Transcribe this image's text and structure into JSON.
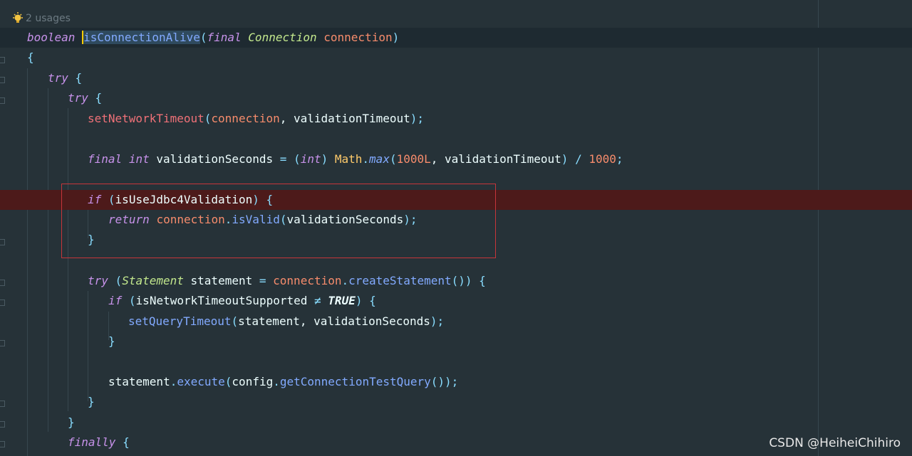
{
  "hint": {
    "usages": "2 usages",
    "icon": "lightbulb-icon"
  },
  "code": {
    "l1": {
      "t1": "boolean",
      "t2": "isConnectionAlive",
      "t3": "(",
      "t4": "final",
      "t5": "Connection",
      "t6": "connection",
      "t7": ")"
    },
    "l2": {
      "t1": "{"
    },
    "l3": {
      "t1": "try",
      "t2": "{"
    },
    "l4": {
      "t1": "try",
      "t2": "{"
    },
    "l5": {
      "t1": "setNetworkTimeout",
      "t2": "(",
      "t3": "connection",
      "t4": ", validationTimeout",
      "t5": ");"
    },
    "l6": {
      "t1": "final",
      "t2": "int",
      "t3": "validationSeconds",
      "t4": "=",
      "t5": "(",
      "t6": "int",
      "t7": ")",
      "t8": "Math",
      "t9": ".",
      "t10": "max",
      "t11": "(",
      "t12": "1000L",
      "t13": ", validationTimeout",
      "t14": ")",
      "t15": "/",
      "t16": "1000",
      "t17": ";"
    },
    "l7": {
      "t1": "if",
      "t2": "(",
      "t3": "isUseJdbc4Validation",
      "t4": ")",
      "t5": "{"
    },
    "l8": {
      "t1": "return",
      "t2": "connection",
      "t3": ".",
      "t4": "isValid",
      "t5": "(",
      "t6": "validationSeconds",
      "t7": ");"
    },
    "l9": {
      "t1": "}"
    },
    "l10": {
      "t1": "try",
      "t2": "(",
      "t3": "Statement",
      "t4": "statement",
      "t5": "=",
      "t6": "connection",
      "t7": ".",
      "t8": "createStatement",
      "t9": "())",
      "t10": "{"
    },
    "l11": {
      "t1": "if",
      "t2": "(",
      "t3": "isNetworkTimeoutSupported",
      "t4": "≠",
      "t5": "TRUE",
      "t6": ")",
      "t7": "{"
    },
    "l12": {
      "t1": "setQueryTimeout",
      "t2": "(",
      "t3": "statement, validationSeconds",
      "t4": ");"
    },
    "l13": {
      "t1": "}"
    },
    "l14": {
      "t1": "statement",
      "t2": ".",
      "t3": "execute",
      "t4": "(",
      "t5": "config",
      "t6": ".",
      "t7": "getConnectionTestQuery",
      "t8": "());"
    },
    "l15": {
      "t1": "}"
    },
    "l16": {
      "t1": "}"
    },
    "l17": {
      "t1": "finally",
      "t2": "{"
    }
  },
  "watermark": "CSDN @HeiheiChihiro",
  "colors": {
    "background": "#263238",
    "breakpoint_line": "#4d1a1a",
    "highlight_box": "#c7353a",
    "keyword": "#c792ea",
    "function": "#82aaff",
    "parameter": "#f78c6c"
  }
}
